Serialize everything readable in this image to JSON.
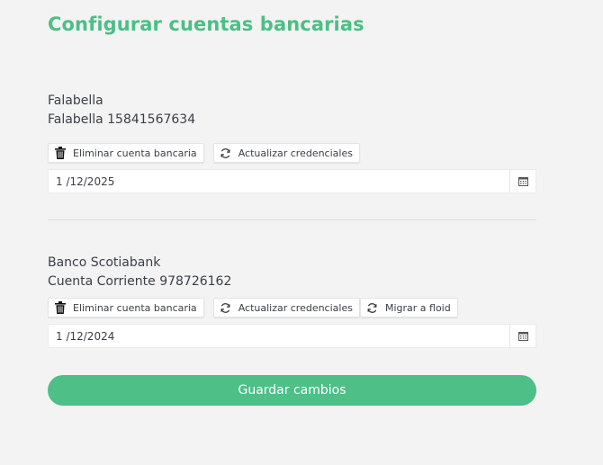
{
  "page": {
    "title": "Configurar cuentas bancarias"
  },
  "accounts": [
    {
      "bank_name": "Falabella",
      "account_label": "Falabella 15841567634",
      "actions": {
        "delete_label": "Eliminar cuenta bancaria",
        "update_label": "Actualizar credenciales"
      },
      "date_value": "1 /12/2025"
    },
    {
      "bank_name": "Banco Scotiabank",
      "account_label": "Cuenta Corriente 978726162",
      "actions": {
        "delete_label": "Eliminar cuenta bancaria",
        "update_label": "Actualizar credenciales",
        "migrate_label": "Migrar a floid"
      },
      "date_value": "1 /12/2024"
    }
  ],
  "footer": {
    "save_label": "Guardar cambios"
  },
  "icons": {
    "delete": "trash-icon",
    "update": "refresh-icon",
    "migrate": "refresh-icon",
    "calendar": "calendar-icon"
  },
  "colors": {
    "accent": "#4cbf86",
    "text": "#3a3f47",
    "background": "#f3f3f3"
  }
}
